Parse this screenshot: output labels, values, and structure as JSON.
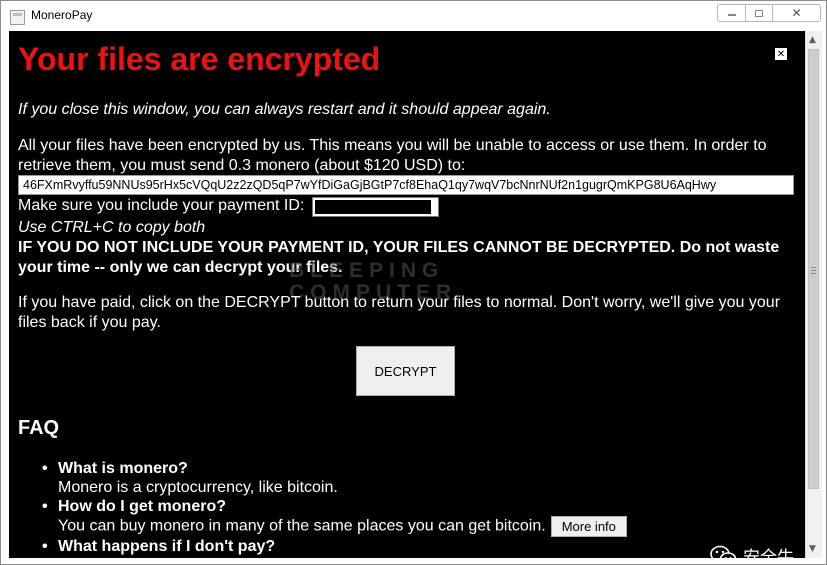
{
  "window": {
    "title": "MoneroPay",
    "controls": {
      "minimize": "",
      "maximize": "",
      "close": "✕"
    }
  },
  "ransom": {
    "heading": "Your files are encrypted",
    "close_note": "If you close this window, you can always restart and it should appear again.",
    "intro": "All your files have been encrypted by us. This means you will be unable to access or use them. In order to retrieve them, you must send 0.3 monero (about $120 USD) to:",
    "wallet_address": "46FXmRvyffu59NNUs95rHx5cVQqU2z2zQD5qP7wYfDiGaGjBGtP7cf8EhaQ1qy7wqV7bcNnrNUf2n1gugrQmKPG8U6AqHwy",
    "payment_id_label": "Make sure you include your payment ID:",
    "copy_note": "Use CTRL+C to copy both",
    "warning": "IF YOU DO NOT INCLUDE YOUR PAYMENT ID, YOUR FILES CANNOT BE DECRYPTED. Do not waste your time -- only we can decrypt your files.",
    "paid_note": "If you have paid, click on the DECRYPT button to return your files to normal. Don't worry, we'll give you your files back if you pay.",
    "decrypt_label": "DECRYPT"
  },
  "watermark": {
    "line1": "BLEEPING",
    "line2": "COMPUTER"
  },
  "faq": {
    "heading": "FAQ",
    "items": [
      {
        "q": "What is monero?",
        "a": "Monero is a cryptocurrency, like bitcoin."
      },
      {
        "q": "How do I get monero?",
        "a": "You can buy monero in many of the same places you can get bitcoin.",
        "button": "More info"
      },
      {
        "q": "What happens if I don't pay?"
      }
    ]
  },
  "badge": {
    "text": "安全牛",
    "icon": "wechat-icon"
  },
  "colors": {
    "heading": "#ee1111",
    "background": "#000000",
    "text": "#ffffff"
  }
}
